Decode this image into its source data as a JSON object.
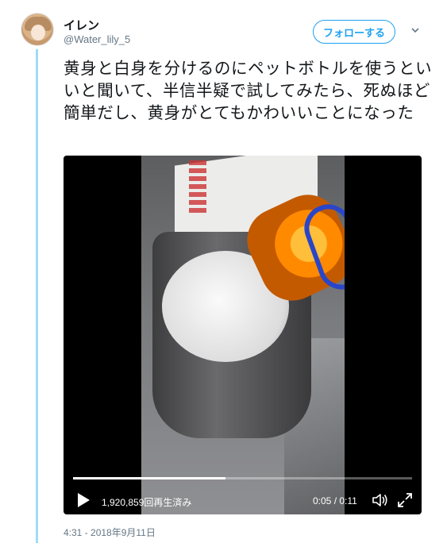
{
  "user": {
    "display_name": "イレン",
    "handle": "@Water_lily_5"
  },
  "header": {
    "follow_label": "フォローする",
    "menu_icon": "chevron-down-icon"
  },
  "tweet": {
    "text": "黄身と白身を分けるのにペットボトルを使うといいと聞いて、半信半疑で試してみたら、死ぬほど簡単だし、黄身がとてもかわいいことになった",
    "timestamp": "4:31 - 2018年9月11日"
  },
  "video": {
    "views": "1,920,859回再生済み",
    "time": "0:05 / 0:11",
    "progress": 0.45,
    "play_icon": "play-icon",
    "volume_icon": "volume-icon",
    "fullscreen_icon": "fullscreen-icon"
  },
  "colors": {
    "accent": "#1da1f2",
    "thread_line": "#9fdcf4",
    "secondary_text": "#657786"
  }
}
